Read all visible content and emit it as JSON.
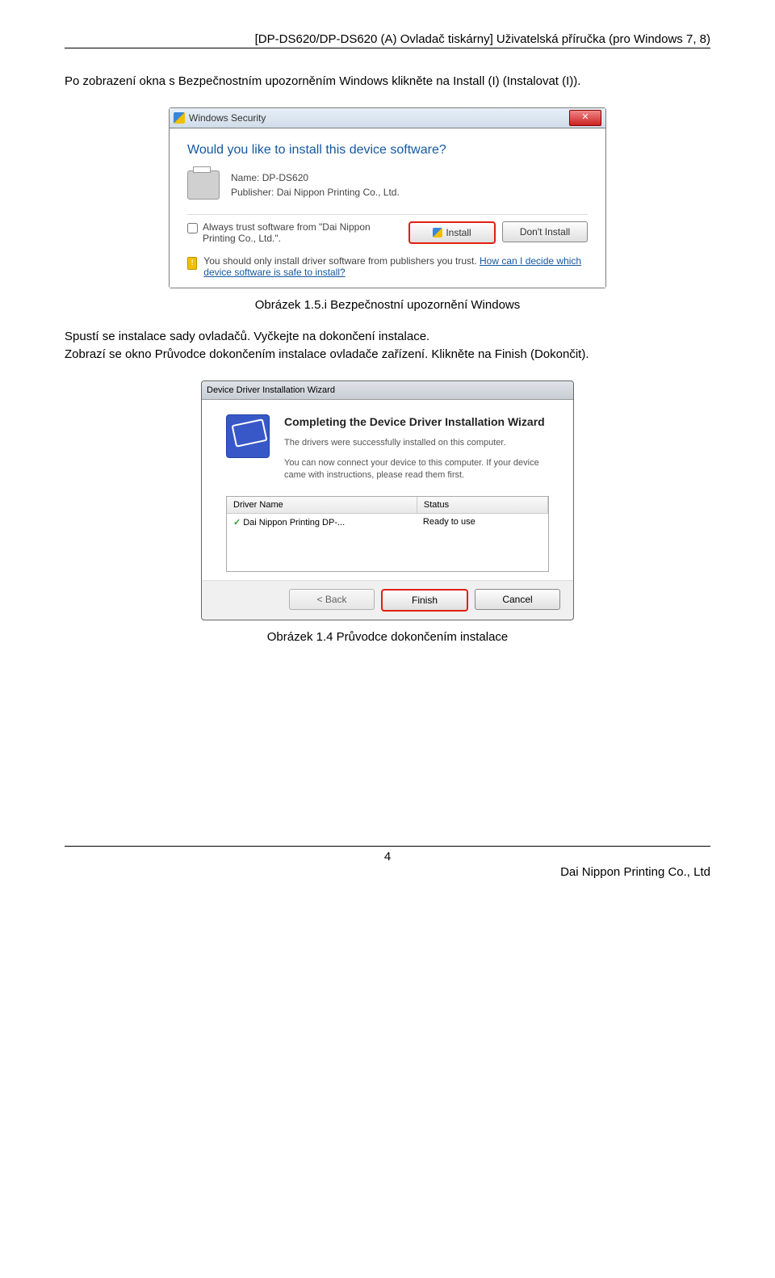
{
  "header": "[DP-DS620/DP-DS620 (A) Ovladač tiskárny] Uživatelská příručka (pro Windows 7, 8)",
  "para1": "Po zobrazení okna s Bezpečnostním upozorněním Windows klikněte na Install (I) (Instalovat (I)).",
  "dialog1": {
    "title": "Windows Security",
    "question": "Would you like to install this device software?",
    "name_lbl": "Name:",
    "name_val": "DP-DS620",
    "pub_lbl": "Publisher:",
    "pub_val": "Dai Nippon Printing Co., Ltd.",
    "trust": "Always trust software from \"Dai Nippon Printing Co., Ltd.\".",
    "install": "Install",
    "dont": "Don't Install",
    "warn": "You should only install driver software from publishers you trust. ",
    "warn_link": "How can I decide which device software is safe to install?"
  },
  "caption1": "Obrázek 1.5.i Bezpečnostní upozornění Windows",
  "para2": "Spustí se instalace sady ovladačů. Vyčkejte na dokončení instalace.\nZobrazí se okno Průvodce dokončením instalace ovladače zařízení. Klikněte na Finish (Dokončit).",
  "dialog2": {
    "title": "Device Driver Installation Wizard",
    "heading": "Completing the Device Driver Installation Wizard",
    "line1": "The drivers were successfully installed on this computer.",
    "line2": "You can now connect your device to this computer. If your device came with instructions, please read them first.",
    "col1": "Driver Name",
    "col2": "Status",
    "drv": "Dai Nippon Printing DP-...",
    "status": "Ready to use",
    "back": "< Back",
    "finish": "Finish",
    "cancel": "Cancel"
  },
  "caption2": "Obrázek 1.4 Průvodce dokončením instalace",
  "page_number": "4",
  "company": "Dai Nippon Printing Co., Ltd"
}
